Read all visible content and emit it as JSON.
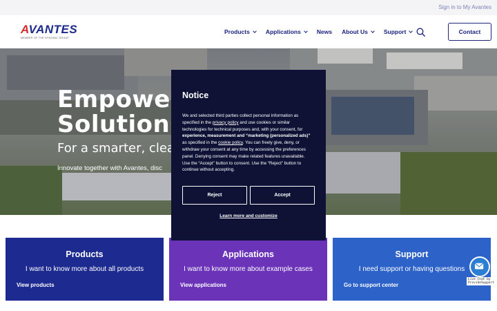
{
  "topbar": {
    "signin_label": "Sign in to My Avantes"
  },
  "brand": {
    "logo_text_a": "A",
    "logo_text_rest": "VANTES",
    "tagline": "MEMBER OF THE NYNOMIC GROUP"
  },
  "nav": {
    "items": [
      {
        "label": "Products",
        "has_dropdown": true
      },
      {
        "label": "Applications",
        "has_dropdown": true
      },
      {
        "label": "News",
        "has_dropdown": false
      },
      {
        "label": "About Us",
        "has_dropdown": true
      },
      {
        "label": "Support",
        "has_dropdown": true
      }
    ],
    "search_icon": "search-icon",
    "contact_label": "Contact"
  },
  "hero": {
    "title": "Empowering\nSolutions",
    "subtitle": "For a smarter, clear",
    "text": "Innovate together with Avantes, disc"
  },
  "cards": [
    {
      "title": "Products",
      "description": "I want to know more about all products",
      "link": "View products",
      "color": "#1d2a8f"
    },
    {
      "title": "Applications",
      "description": "I want to know more about example cases",
      "link": "View applications",
      "color": "#6a33b8"
    },
    {
      "title": "Support",
      "description": "I need support or having questions",
      "link": "Go to support center",
      "color": "#2d62c8"
    }
  ],
  "notice": {
    "title": "Notice",
    "p1": "We and selected third parties collect personal information as specified in the ",
    "privacy_link": "privacy policy",
    "p2": " and use cookies or similar technologies for technical purposes and, with your consent, for ",
    "p2_bold": "experience, measurement and “marketing (personalized ads)”",
    "p3": " as specified in the ",
    "cookie_link": "cookie policy",
    "p4": ". You can freely give, deny, or withdraw your consent at any time by accessing the preferences panel. Denying consent may make related features unavailable.",
    "p5": "Use the “Accept” button to consent. Use the “Reject” button to continue without accepting.",
    "reject_label": "Reject",
    "accept_label": "Accept",
    "learn_more_label": "Learn more and customize"
  },
  "chat": {
    "icon": "chat-envelope-icon",
    "label": "Live Chat by ProvideSupport"
  },
  "colors": {
    "navy": "#1a237e",
    "modal_bg": "#0f1235",
    "accent_red": "#d62b2b"
  }
}
